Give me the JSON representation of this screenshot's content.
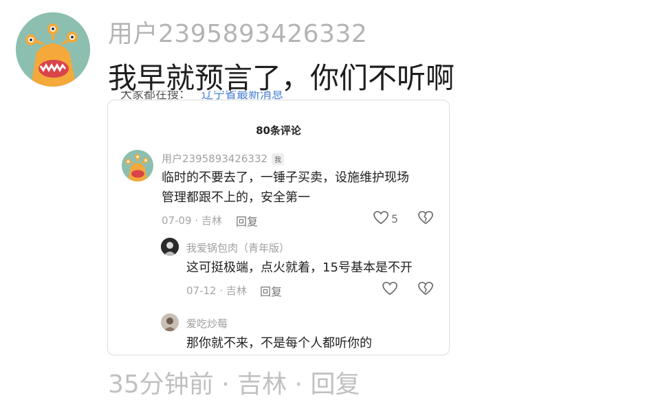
{
  "post": {
    "username": "用户2395893426332",
    "comment": "我早就预言了，你们不听啊",
    "peek_top_left": "大家都在搜：",
    "peek_top_link": "辽宁省最新消息",
    "peek_bottom": "35分钟前 · 吉林 · 回复"
  },
  "card": {
    "title": "80条评论",
    "comments": [
      {
        "username": "用户2395893426332",
        "badge": "我",
        "line1": "临时的不要去了，一锤子买卖，设施维护现场",
        "line2": "管理都跟不上的，安全第一",
        "meta": "07-09 · 吉林",
        "reply": "回复",
        "likes": "5"
      },
      {
        "username": "我爱锅包肉（青年版）",
        "line1": "这可挺极端，点火就着，15号基本是不开",
        "meta": "07-12 · 吉林",
        "reply": "回复"
      },
      {
        "username": "爱吃炒莓",
        "line1": "那你就不来，不是每个人都听你的"
      }
    ]
  },
  "colors": {
    "avatar_bg": "#8dbfb0",
    "monster_orange": "#f4a93a",
    "link_blue": "#4a7fd6"
  }
}
